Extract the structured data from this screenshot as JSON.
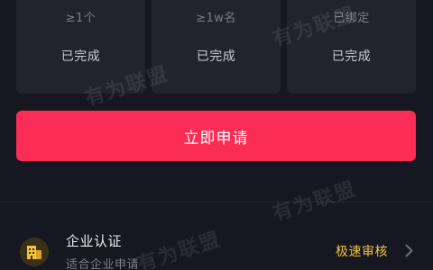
{
  "cards": [
    {
      "requirement": "≥1个",
      "status": "已完成"
    },
    {
      "requirement": "≥1w名",
      "status": "已完成"
    },
    {
      "requirement": "已绑定",
      "status": "已完成"
    }
  ],
  "apply_button": {
    "label": "立即申请"
  },
  "enterprise": {
    "title": "企业认证",
    "subtitle": "适合企业申请",
    "action_label": "极速审核",
    "icon": "building-icon",
    "chevron_icon": "chevron-right-icon"
  },
  "watermark": {
    "text": "有为联盟"
  },
  "colors": {
    "background": "#161720",
    "card": "#22232d",
    "accent": "#fb2c55",
    "highlight": "#f4c23d"
  }
}
